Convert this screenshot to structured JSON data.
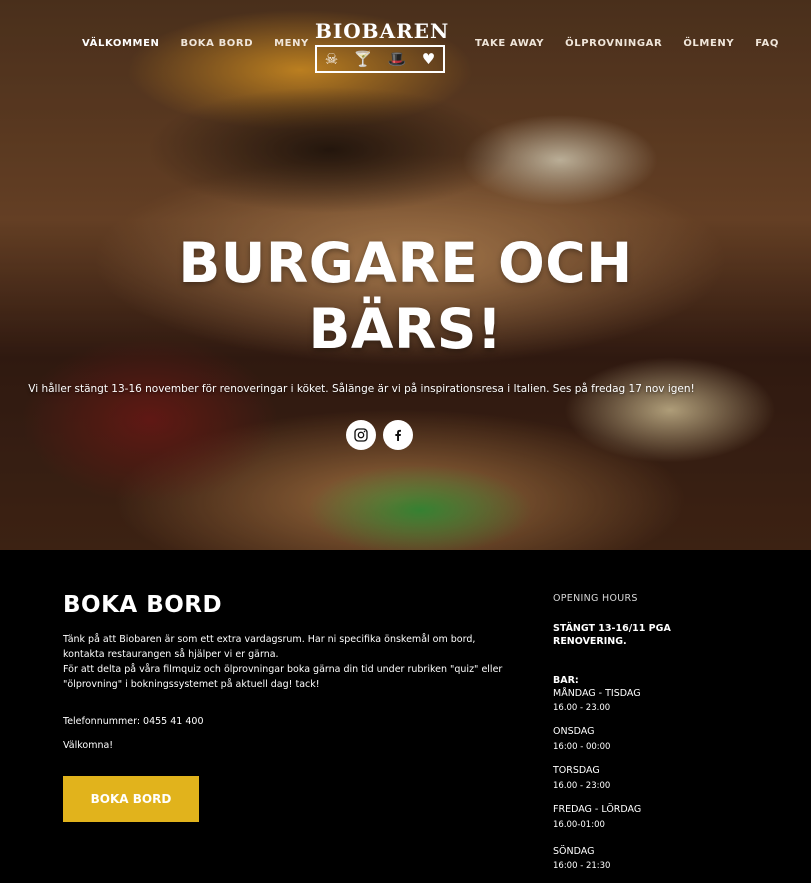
{
  "nav": {
    "left": [
      "VÄLKOMMEN",
      "BOKA BORD",
      "MENY"
    ],
    "right": [
      "TAKE AWAY",
      "ÖLPROVNINGAR",
      "ÖLMENY",
      "FAQ"
    ]
  },
  "logo": {
    "text": "BIOBAREN"
  },
  "hero": {
    "title_line1": "BURGARE OCH",
    "title_line2": "BÄRS!",
    "subtitle": "Vi håller stängt 13-16 november för renoveringar i köket. Sålänge är vi på inspirationsresa i Italien. Ses på fredag 17 nov igen!"
  },
  "social": {
    "instagram": "instagram-icon",
    "facebook": "facebook-icon"
  },
  "booking": {
    "title": "BOKA BORD",
    "para1": "Tänk på att Biobaren är som ett extra vardagsrum. Har ni specifika önskemål om bord, kontakta restaurangen så hjälper vi er gärna.",
    "para2": "För att delta på våra filmquiz och ölprovningar boka gärna din tid under rubriken  \"quiz\" eller \"ölprovning\" i bokningssystemet på aktuell dag! tack!",
    "phone": "Telefonnummer: 0455 41 400",
    "welcome": "Välkomna!",
    "button": "BOKA BORD",
    "button_color": "#e1b31c"
  },
  "hours": {
    "title": "OPENING HOURS",
    "closed_line1": "STÄNGT 13-16/11 PGA",
    "closed_line2": "RENOVERING.",
    "bar_label": "BAR:",
    "days": [
      {
        "day": "MÅNDAG - TISDAG",
        "time": "16.00 - 23.00"
      },
      {
        "day": "ONSDAG",
        "time": "16:00 - 00:00"
      },
      {
        "day": "TORSDAG",
        "time": "16.00 - 23:00"
      },
      {
        "day": "FREDAG - LÖRDAG",
        "time": "16.00-01:00"
      },
      {
        "day": "SÖNDAG",
        "time": "16:00 - 21:30"
      }
    ]
  }
}
